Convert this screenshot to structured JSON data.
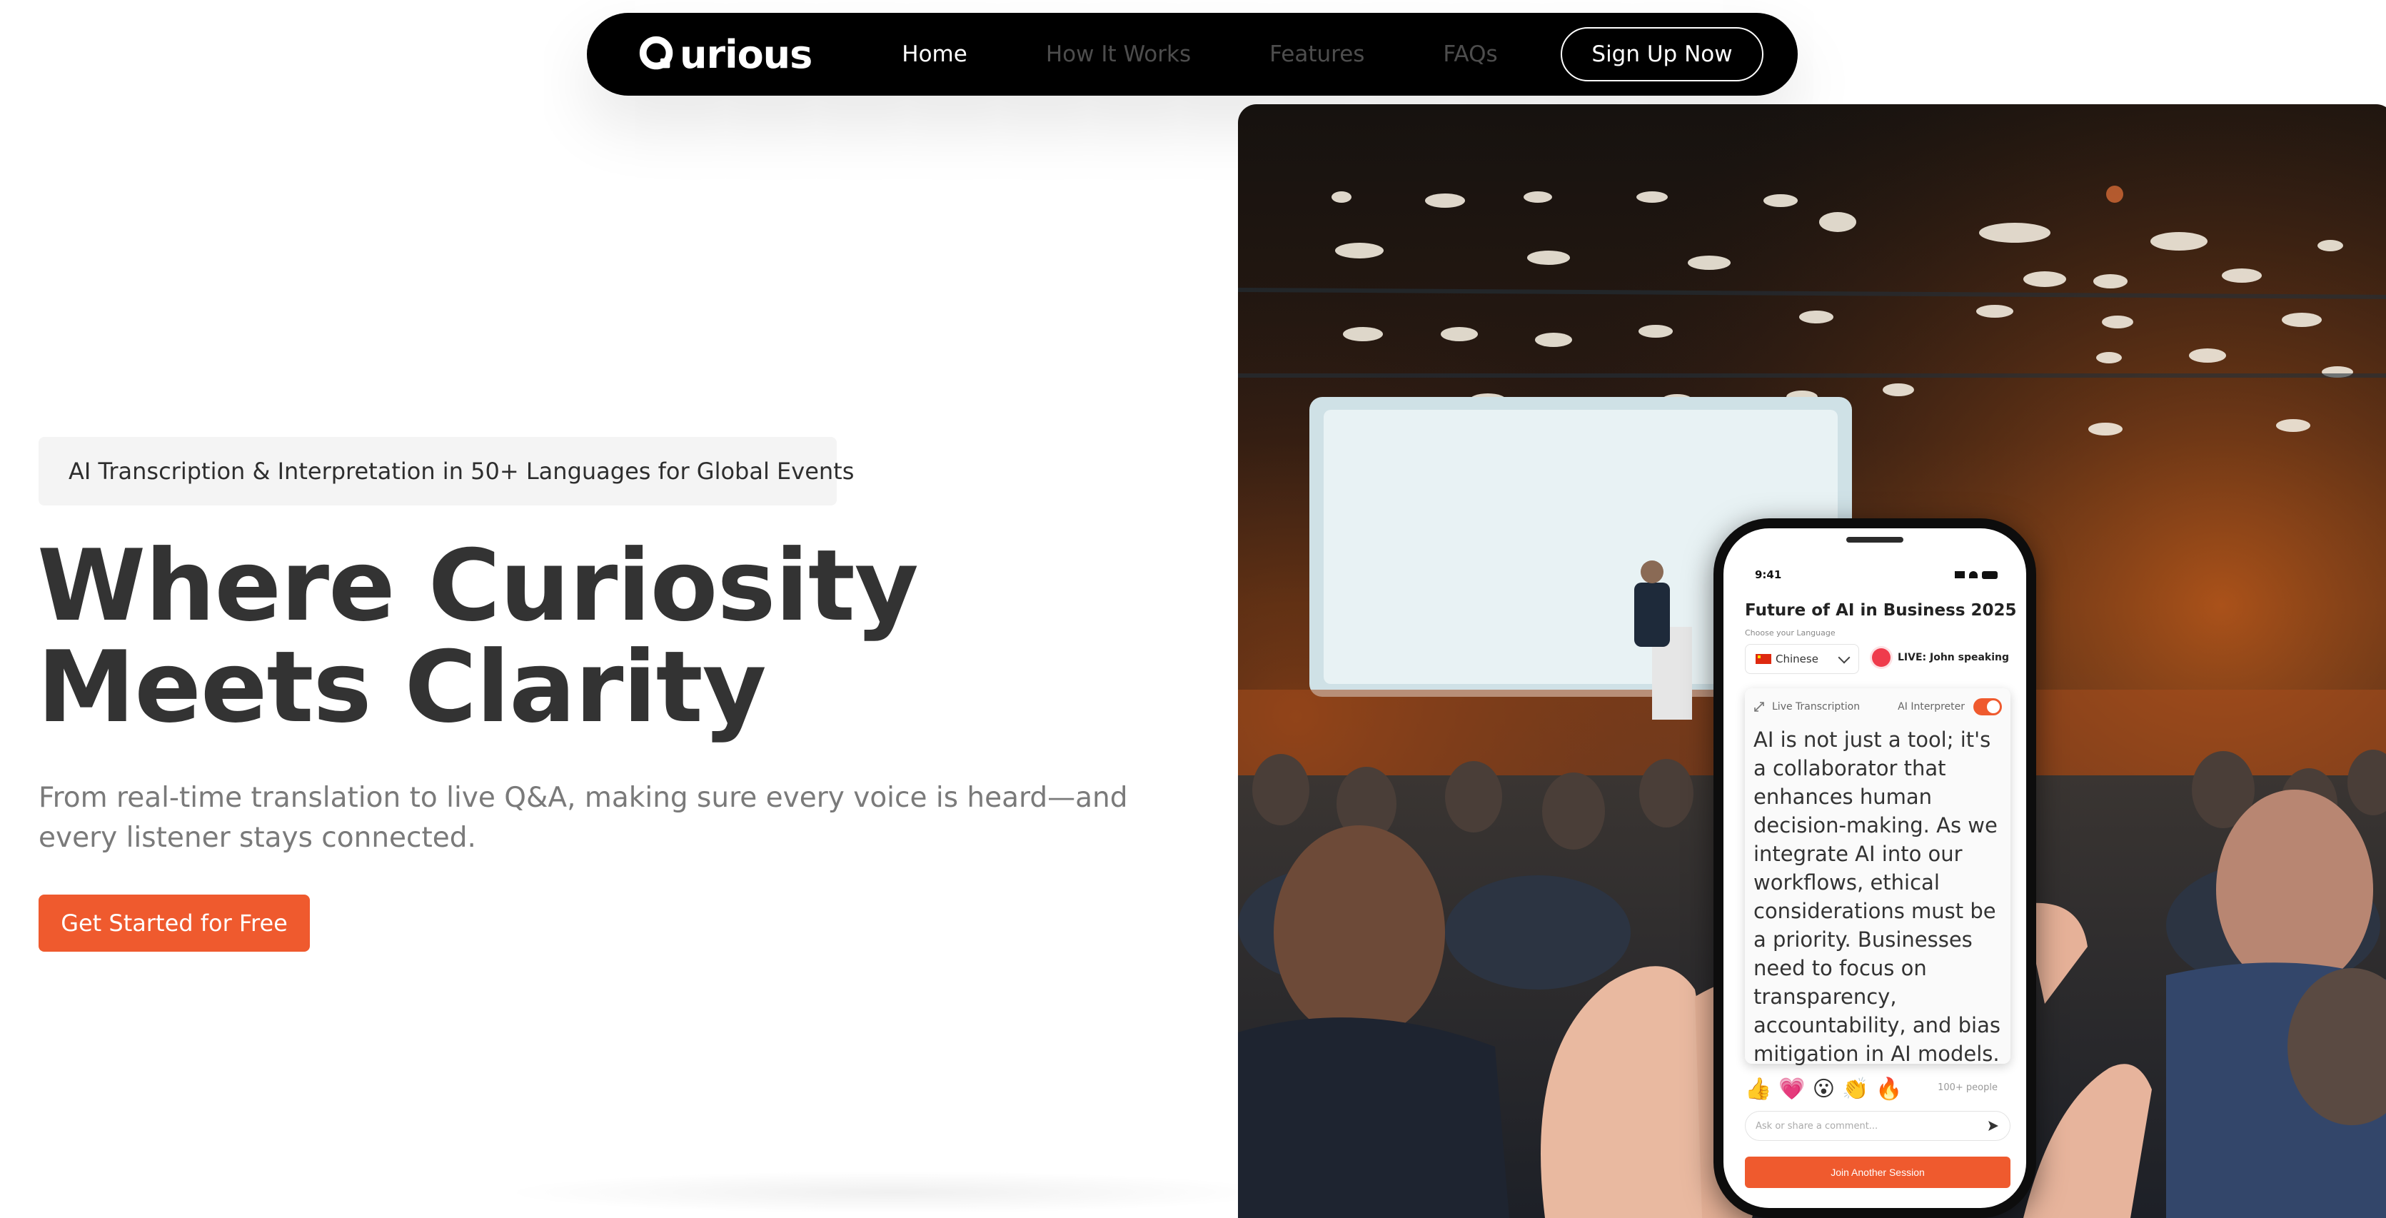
{
  "nav": {
    "logo": "urious",
    "links": [
      "Home",
      "How It Works",
      "Features",
      "FAQs"
    ],
    "signup_label": "Sign Up Now"
  },
  "hero": {
    "badge": "AI Transcription & Interpretation in 50+ Languages for Global Events",
    "title_line1": "Where Curiosity",
    "title_line2": "Meets Clarity",
    "subtitle": "From real-time translation to live Q&A, making sure every voice is heard—and every listener stays connected.",
    "cta_label": "Get Started for Free"
  },
  "phone": {
    "time": "9:41",
    "event_title": "Future of AI in Business 2025",
    "language_label": "Choose your Language",
    "language_value": "Chinese",
    "live_status": "LIVE: John speaking",
    "transcription_label": "Live Transcription",
    "interpreter_label": "AI Interpreter",
    "transcript": "AI is not just a tool; it's a collaborator that enhances human decision-making. As we integrate AI into our workflows, ethical considerations must be a priority. Businesses need to focus on transparency, accountability, and bias mitigation in AI models.",
    "reactions": [
      "👍",
      "💗",
      "😮",
      "👏",
      "🔥"
    ],
    "people_count": "100+ people",
    "comment_placeholder": "Ask or share a comment...",
    "join_label": "Join Another Session"
  },
  "colors": {
    "accent": "#ef5a2e",
    "nav_bg": "#000000",
    "heading": "#333333",
    "muted": "#7a7a7a",
    "live_dot": "#ef3b4c"
  },
  "icons": [
    "q-logo-icon",
    "globe-icon",
    "chevron-down-icon",
    "expand-icon",
    "send-icon"
  ]
}
